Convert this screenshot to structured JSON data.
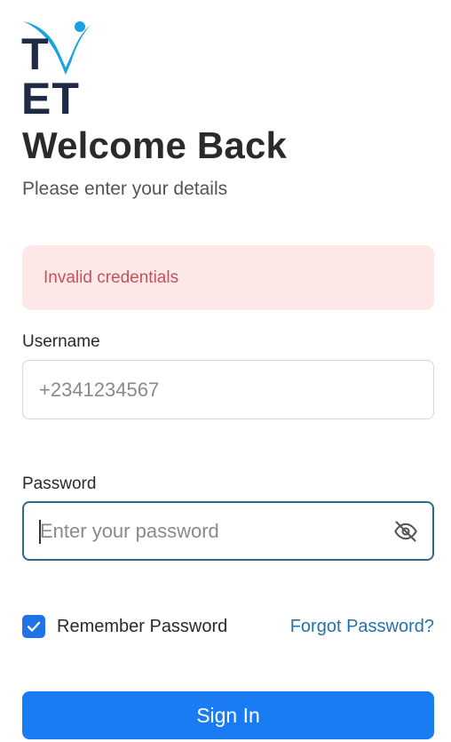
{
  "brand": {
    "logo_text_left": "T",
    "logo_text_right": "ET",
    "logo_accent_color": "#1ba0e0",
    "logo_text_color": "#1f2a44"
  },
  "header": {
    "title": "Welcome Back",
    "subtitle": "Please enter your details"
  },
  "alert": {
    "message": "Invalid credentials",
    "background": "#fde8e8",
    "text_color": "#c4525a"
  },
  "form": {
    "username": {
      "label": "Username",
      "value": "",
      "placeholder": "+2341234567"
    },
    "password": {
      "label": "Password",
      "value": "",
      "placeholder": "Enter your password",
      "toggle_icon": "eye-off-icon"
    },
    "remember": {
      "label": "Remember Password",
      "checked": true
    },
    "forgot_link": "Forgot Password?",
    "submit_label": "Sign In"
  },
  "colors": {
    "primary": "#1a7cf3",
    "link": "#2472a8",
    "focus_border": "#2c6a8c"
  }
}
